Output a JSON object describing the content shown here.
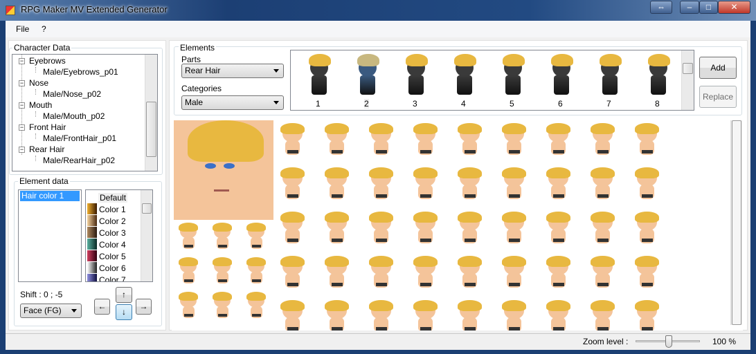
{
  "window": {
    "title": "RPG Maker MV Extended Generator",
    "buttons": [
      "⇔",
      "–",
      "□",
      "✕"
    ]
  },
  "menu": [
    "File",
    "?"
  ],
  "character_data": {
    "label": "Character Data",
    "tree": [
      {
        "name": "Eyebrows",
        "child": "Male/Eyebrows_p01"
      },
      {
        "name": "Nose",
        "child": "Male/Nose_p02"
      },
      {
        "name": "Mouth",
        "child": "Male/Mouth_p02"
      },
      {
        "name": "Front Hair",
        "child": "Male/FrontHair_p01"
      },
      {
        "name": "Rear Hair",
        "child": "Male/RearHair_p02"
      }
    ]
  },
  "element_data": {
    "label": "Element data",
    "list": [
      "Hair color 1"
    ],
    "colors": [
      {
        "label": "Default",
        "swatch": null
      },
      {
        "label": "Color 1",
        "swatch": [
          "#f0b030",
          "#3a1a00"
        ]
      },
      {
        "label": "Color 2",
        "swatch": [
          "#f5d3a0",
          "#4a2a10"
        ]
      },
      {
        "label": "Color 3",
        "swatch": [
          "#b08a60",
          "#2a1a10"
        ]
      },
      {
        "label": "Color 4",
        "swatch": [
          "#5ab0a0",
          "#0a2a25"
        ]
      },
      {
        "label": "Color 5",
        "swatch": [
          "#d04060",
          "#300010"
        ]
      },
      {
        "label": "Color 6",
        "swatch": [
          "#ffffff",
          "#202020"
        ]
      },
      {
        "label": "Color 7",
        "swatch": [
          "#9090e0",
          "#101040"
        ]
      }
    ],
    "shift": "Shift : 0 ; -5",
    "layer": "Face (FG)",
    "arrows": {
      "up": "↑",
      "down": "↓",
      "left": "←",
      "right": "→"
    }
  },
  "elements": {
    "label": "Elements",
    "parts_label": "Parts",
    "parts_value": "Rear Hair",
    "categories_label": "Categories",
    "categories_value": "Male",
    "thumbnails": [
      "1",
      "2",
      "3",
      "4",
      "5",
      "6",
      "7",
      "8"
    ],
    "selected": "2",
    "add": "Add",
    "replace": "Replace"
  },
  "colors": {
    "hair": "#e8b840",
    "skin": "#f4c49a",
    "selection": "#3399ff"
  },
  "status": {
    "zoom_label": "Zoom level :",
    "zoom_value": "100 %",
    "zoom_fraction": 0.5
  }
}
